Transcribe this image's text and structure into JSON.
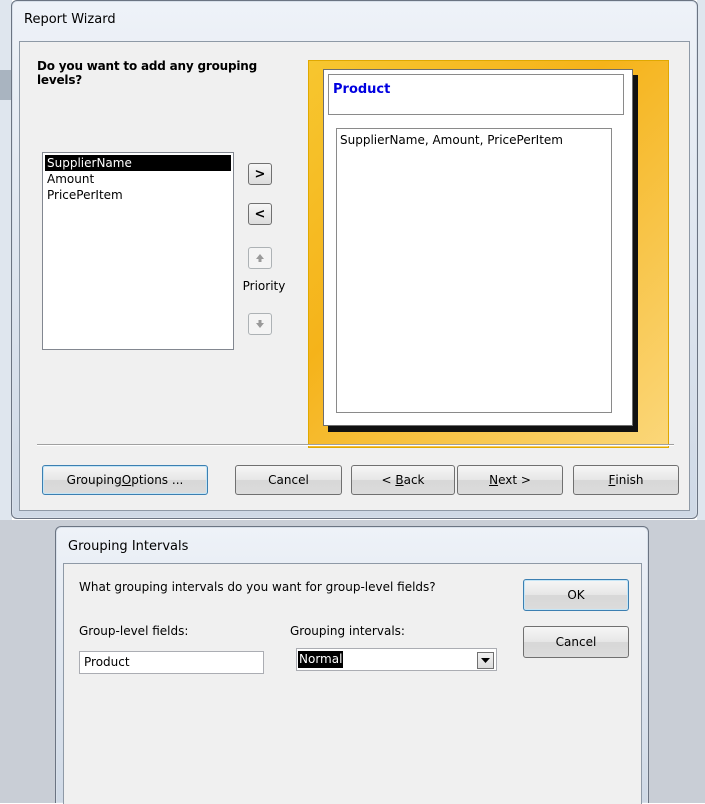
{
  "report_wizard": {
    "title": "Report Wizard",
    "prompt": "Do you want to add any grouping levels?",
    "fields": [
      "SupplierName",
      "Amount",
      "PricePerItem"
    ],
    "selected_field": "SupplierName",
    "add_button": ">",
    "remove_button": "<",
    "priority_label": "Priority",
    "preview_group_header": "Product",
    "preview_fields": "SupplierName, Amount, PricePerItem",
    "buttons": {
      "grouping_options_prefix": "Grouping ",
      "grouping_options_accel": "O",
      "grouping_options_suffix": "ptions ...",
      "cancel": "Cancel",
      "back_prefix": "< ",
      "back_accel": "B",
      "back_suffix": "ack",
      "next_accel": "N",
      "next_suffix": "ext >",
      "finish_accel": "F",
      "finish_suffix": "inish"
    }
  },
  "grouping_intervals": {
    "title": "Grouping Intervals",
    "question": "What grouping intervals do you want for group-level fields?",
    "group_level_label": "Group-level fields:",
    "grouping_intervals_label": "Grouping intervals:",
    "group_field_value": "Product",
    "interval_value": "Normal",
    "ok": "OK",
    "cancel": "Cancel"
  },
  "colors": {
    "preview_border": "#f5b31a",
    "header_text": "#0000e0",
    "selection": "#000000"
  }
}
